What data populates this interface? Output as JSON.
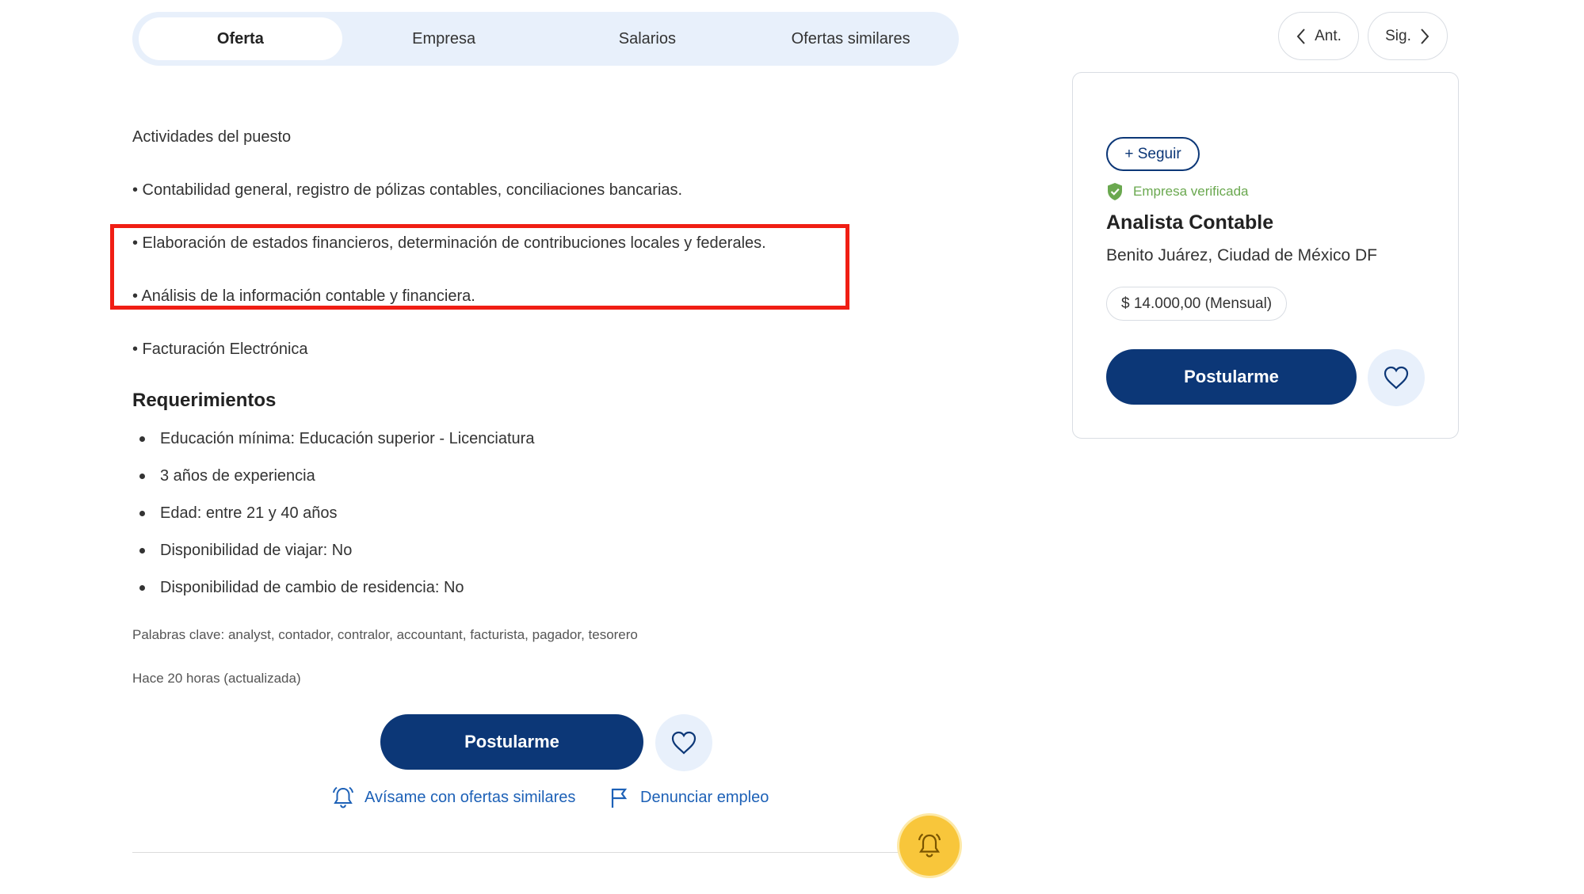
{
  "tabs": [
    "Oferta",
    "Empresa",
    "Salarios",
    "Ofertas similares"
  ],
  "nav": {
    "prev": "Ant.",
    "next": "Sig."
  },
  "description": {
    "heading": "Actividades del puesto",
    "lines": [
      "• Contabilidad general, registro de pólizas contables, conciliaciones bancarias.",
      "• Elaboración de estados financieros, determinación de contribuciones locales y federales.",
      "• Análisis de la información contable y financiera.",
      "• Facturación Electrónica"
    ]
  },
  "requirements": {
    "title": "Requerimientos",
    "items": [
      "Educación mínima: Educación superior - Licenciatura",
      "3 años de experiencia",
      "Edad: entre 21 y 40 años",
      "Disponibilidad de viajar: No",
      "Disponibilidad de cambio de residencia: No"
    ]
  },
  "keywords": "Palabras clave: analyst, contador, contralor, accountant, facturista, pagador, tesorero",
  "posted": "Hace 20 horas (actualizada)",
  "actions": {
    "apply": "Postularme",
    "alert_link": "Avísame con ofertas similares",
    "report_link": "Denunciar empleo"
  },
  "card": {
    "follow": "+ Seguir",
    "verified": "Empresa verificada",
    "title": "Analista Contable",
    "location": "Benito Juárez, Ciudad de México DF",
    "salary": "$ 14.000,00 (Mensual)",
    "apply": "Postularme"
  },
  "colors": {
    "primary": "#0c3777",
    "link": "#1d61b7",
    "tab_bg": "#e8f0fb",
    "verified": "#6aa84f",
    "highlight": "#f01e14",
    "fab": "#f8c63b"
  }
}
